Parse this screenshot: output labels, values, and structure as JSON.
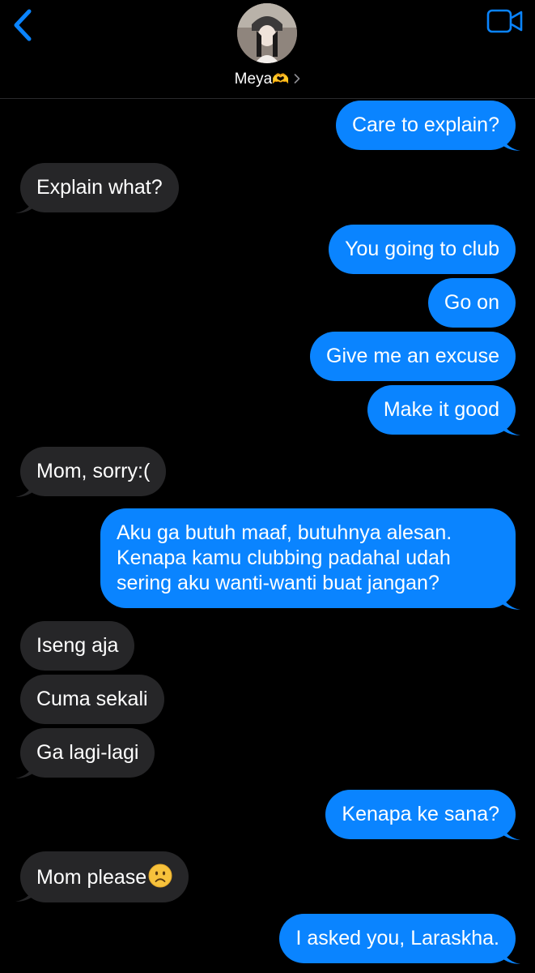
{
  "header": {
    "contact_name": "Meya",
    "contact_emoji": "🫶",
    "back_icon": "chevron-left-icon",
    "video_icon": "video-camera-icon",
    "accent_color": "#0a84ff"
  },
  "messages": [
    {
      "from": "me",
      "text": "Care to explain?"
    },
    {
      "from": "them",
      "text": "Explain what?"
    },
    {
      "from": "me",
      "text": "You going to club"
    },
    {
      "from": "me",
      "text": "Go on"
    },
    {
      "from": "me",
      "text": "Give me an excuse"
    },
    {
      "from": "me",
      "text": "Make it good"
    },
    {
      "from": "them",
      "text": "Mom, sorry:("
    },
    {
      "from": "me",
      "text": "Aku ga butuh maaf, butuhnya alesan. Kenapa kamu clubbing padahal udah sering aku wanti-wanti buat jangan?"
    },
    {
      "from": "them",
      "text": "Iseng aja"
    },
    {
      "from": "them",
      "text": "Cuma sekali"
    },
    {
      "from": "them",
      "text": "Ga lagi-lagi"
    },
    {
      "from": "me",
      "text": "Kenapa ke sana?"
    },
    {
      "from": "them",
      "text": "Mom please",
      "emoji": "frowning-face-icon"
    },
    {
      "from": "me",
      "text": "I asked you, Laraskha."
    }
  ],
  "colors": {
    "sent_bubble": "#0a84ff",
    "received_bubble": "#262628",
    "background": "#000000"
  }
}
